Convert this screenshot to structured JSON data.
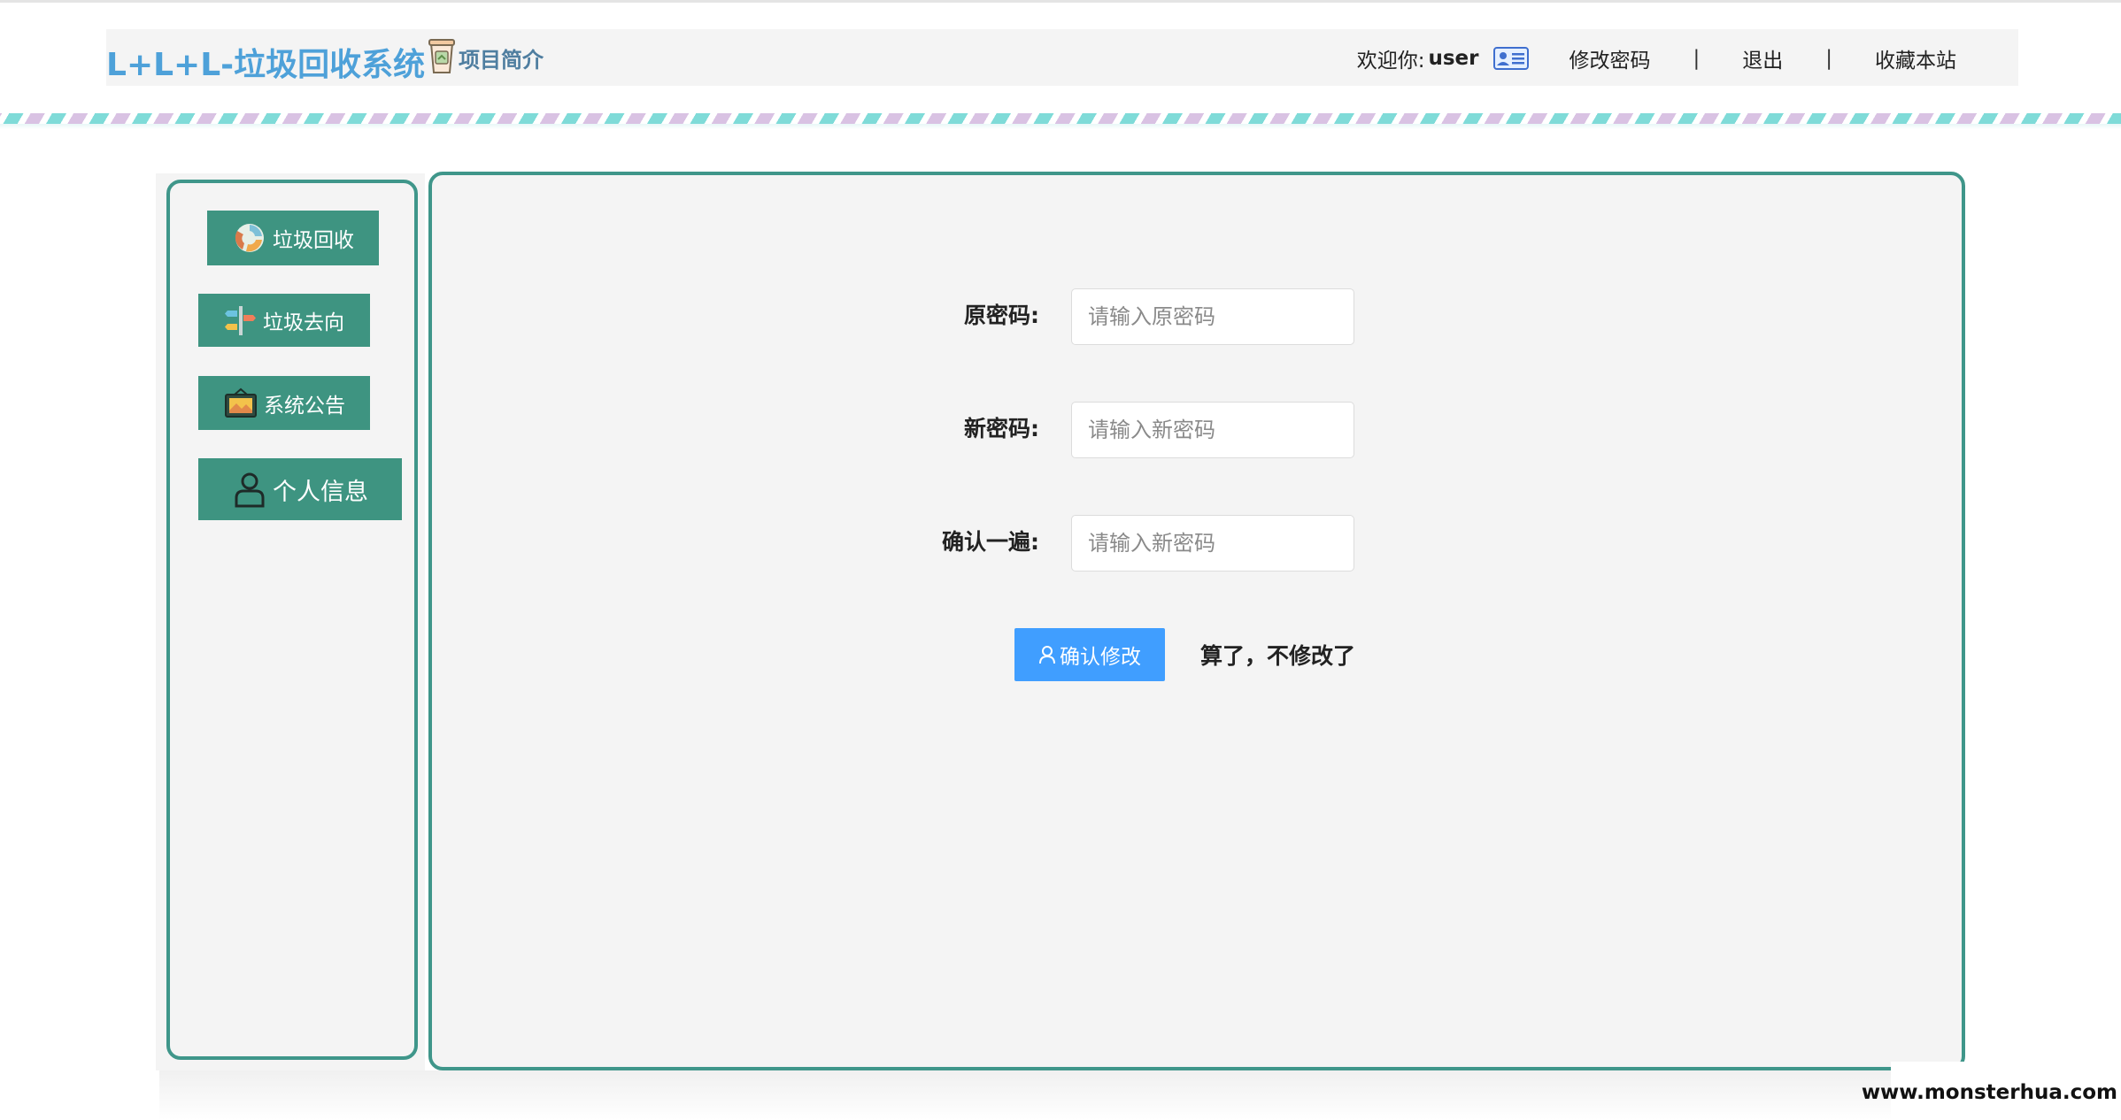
{
  "header": {
    "title": "L+L+L-垃圾回收系统",
    "intro_label": "项目简介",
    "welcome_label": "欢迎你:",
    "username": "user",
    "change_password": "修改密码",
    "separator": "|",
    "logout": "退出",
    "bookmark": "收藏本站"
  },
  "sidebar": {
    "items": [
      {
        "label": "垃圾回收",
        "icon": "recycle-icon"
      },
      {
        "label": "垃圾去向",
        "icon": "signpost-icon"
      },
      {
        "label": "系统公告",
        "icon": "announcement-icon"
      },
      {
        "label": "个人信息",
        "icon": "user-icon"
      }
    ]
  },
  "form": {
    "old_password_label": "原密码:",
    "old_password_placeholder": "请输入原密码",
    "new_password_label": "新密码:",
    "new_password_placeholder": "请输入新密码",
    "confirm_password_label": "确认一遍:",
    "confirm_password_placeholder": "请输入新密码",
    "submit_label": "确认修改",
    "cancel_label": "算了，不修改了"
  },
  "watermark": "www.monsterhua.com",
  "colors": {
    "brand_title": "#4ea1d9",
    "panel_border": "#3f968a",
    "nav_button": "#3e9481",
    "primary_button": "#409eff"
  }
}
